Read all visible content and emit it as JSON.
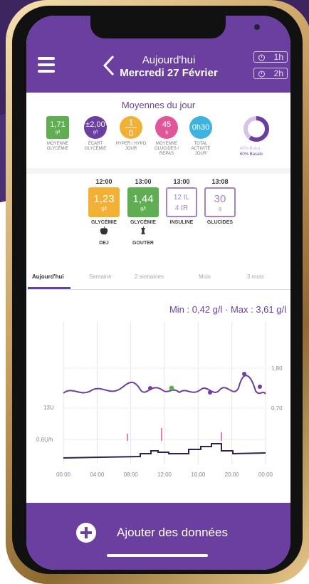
{
  "header": {
    "title": "Aujourd'hui",
    "date": "Mercredi 27 Février",
    "time_buttons": [
      "1h",
      "2h"
    ]
  },
  "daily_averages": {
    "title": "Moyennes du jour",
    "stats": [
      {
        "value": "1,71",
        "unit": "g/l",
        "label": "MOYENNE GLYCÉMIE",
        "color": "#5fae52"
      },
      {
        "value": "±2,00",
        "unit": "g/l",
        "label": "ÉCART GLYCÉMIE",
        "color": "#6b3fa0"
      },
      {
        "value": "1",
        "value2": "0",
        "label": "HYPER / HYPO JOUR",
        "color": "#f2b134"
      },
      {
        "value": "45",
        "unit": "g",
        "label": "MOYENNE GLUCIDES / REPAS",
        "color": "#e0569a"
      },
      {
        "value": "0h30",
        "label": "TOTAL ACTIVITÉ JOUR",
        "color": "#3db3df"
      }
    ],
    "bolus_pct": "40% Bolus",
    "basale_pct": "60% Basale",
    "bolus_fraction": 0.4
  },
  "events": [
    {
      "time": "12:00",
      "value": "1,23",
      "unit": "g/l",
      "type": "GLYCÉMIE",
      "meal": "DEJ",
      "color": "#f2b134",
      "outline": false
    },
    {
      "time": "13:00",
      "value": "1,44",
      "unit": "g/l",
      "type": "GLYCÉMIE",
      "meal": "GOUTER",
      "color": "#5fae52",
      "outline": false
    },
    {
      "time": "13:00",
      "value": "12 IL",
      "unit": "4 IR",
      "type": "INSULINE",
      "meal": "",
      "color": "#a882c8",
      "outline": true
    },
    {
      "time": "13:08",
      "value": "30",
      "unit": "g",
      "type": "GLUCIDES",
      "meal": "",
      "color": "#a882c8",
      "outline": true
    }
  ],
  "tabs": [
    "Aujourd'hui",
    "Semaine",
    "2 semaines",
    "Mois",
    "3 mois"
  ],
  "active_tab": 0,
  "minmax": "Min : 0,42 g/l · Max : 3,61 g/l",
  "chart_data": {
    "type": "line",
    "x": [
      "00:00",
      "04:00",
      "08:00",
      "12:00",
      "16:00",
      "20:00",
      "00:00"
    ],
    "right_ticks": [
      "1,80",
      "0,70"
    ],
    "left_ticks": [
      "13U",
      "0.6U/h"
    ],
    "glucose_line_color": "#6b3fa0",
    "insulin_line_color": "#2d2255"
  },
  "footer": {
    "add_label": "Ajouter des données"
  }
}
